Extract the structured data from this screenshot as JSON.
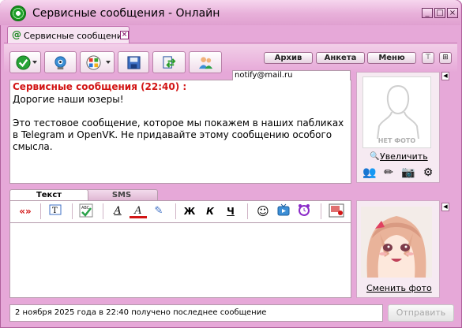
{
  "window": {
    "title": "Сервисные сообщения - Онлайн",
    "controls": {
      "minimize": "_",
      "maximize": "□",
      "close": "×"
    }
  },
  "tab": {
    "label": "Сервисные сообщения",
    "close": "×"
  },
  "toolbar": {
    "icons": [
      "status-check-icon",
      "webcam-icon",
      "apps-icon",
      "save-icon",
      "file-transfer-icon",
      "contacts-icon"
    ],
    "archive_label": "Архив",
    "profile_label": "Анкета",
    "menu_label": "Меню"
  },
  "chat": {
    "email": "notify@mail.ru",
    "header": "Сервисные сообщения (22:40) :",
    "lines": [
      "Дорогие наши юзеры!",
      "",
      "Это тестовое сообщение, которое мы покажем в наших пабликах в Telegram и OpenVK. Не придавайте этому сообщению особого смысла."
    ]
  },
  "contact_panel": {
    "no_photo": "НЕТ ФОТО",
    "zoom_label": "Увеличить"
  },
  "composer": {
    "tab_text": "Текст",
    "tab_sms": "SMS",
    "translit": "«»",
    "bold": "Ж",
    "italic": "К",
    "underline": "Ч"
  },
  "user_panel": {
    "change_photo_label": "Сменить фото"
  },
  "status": {
    "text": "2 ноября 2025 года в 22:40 получено последнее сообщение"
  },
  "send_label": "Отправить",
  "colors": {
    "accent": "#e6a8d8",
    "header_red": "#d21515"
  }
}
